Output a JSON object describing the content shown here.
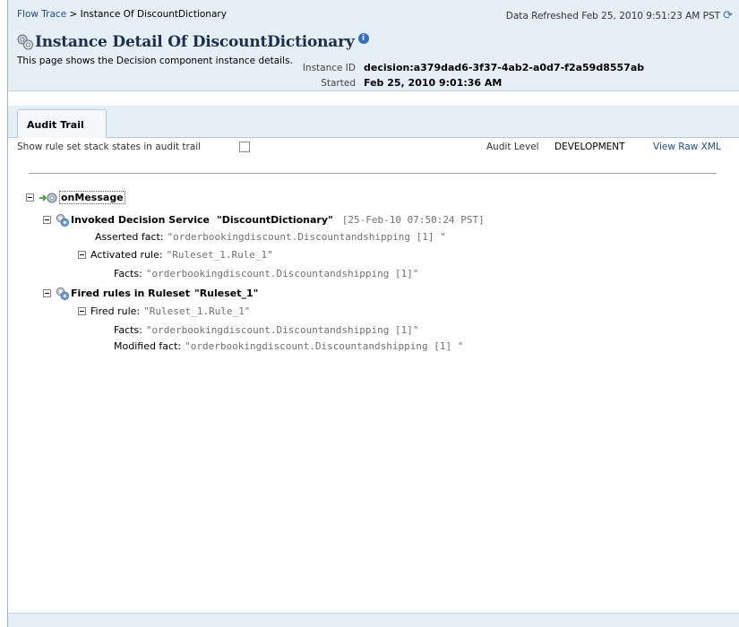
{
  "header": {
    "breadcrumb": {
      "link": "Flow Trace",
      "separator": " > ",
      "current": "Instance Of DiscountDictionary"
    },
    "data_refreshed": "Data Refreshed Feb 25, 2010 9:51:23 AM PST",
    "title": "Instance Detail Of DiscountDictionary",
    "description": "This page shows the Decision component instance details.",
    "instance_id_label": "Instance ID",
    "instance_id_value": "decision:a379dad6-3f37-4ab2-a0d7-f2a59d8557ab",
    "started_label": "Started",
    "started_value": "Feb 25, 2010 9:01:36 AM"
  },
  "tabs": [
    {
      "label": "Audit Trail",
      "active": true
    }
  ],
  "options": {
    "show_stack_label": "Show rule set stack states in audit trail",
    "show_stack_checked": false,
    "audit_level_label": "Audit Level",
    "audit_level_value": "DEVELOPMENT",
    "view_raw_xml": "View Raw XML"
  },
  "tree": {
    "root": "onMessage",
    "invoked": {
      "label": "Invoked Decision Service",
      "name": "\"DiscountDictionary\"",
      "timestamp": "[25-Feb-10 07:50:24 PST]",
      "asserted_label": "Asserted fact:",
      "asserted_value": "\"orderbookingdiscount.Discountandshipping [1] \"",
      "activated_label": "Activated rule:",
      "activated_value": "\"Ruleset_1.Rule_1\"",
      "facts_label": "Facts:",
      "facts_value": "\"orderbookingdiscount.Discountandshipping [1]\""
    },
    "fired": {
      "label": "Fired rules in Ruleset",
      "name": "\"Ruleset_1\"",
      "rule_label": "Fired rule:",
      "rule_value": "\"Ruleset_1.Rule_1\"",
      "facts_label": "Facts:",
      "facts_value": "\"orderbookingdiscount.Discountandshipping [1]\"",
      "modified_label": "Modified fact:",
      "modified_value": "\"orderbookingdiscount.Discountandshipping [1] \""
    }
  },
  "colors": {
    "header_bg": "#e6eef6",
    "link": "#1f4b99",
    "value_gray": "#707070"
  },
  "icons": [
    "refresh-icon",
    "settings-gears-icon",
    "info-icon",
    "arrow-gear-icon",
    "decision-gear-icon"
  ]
}
